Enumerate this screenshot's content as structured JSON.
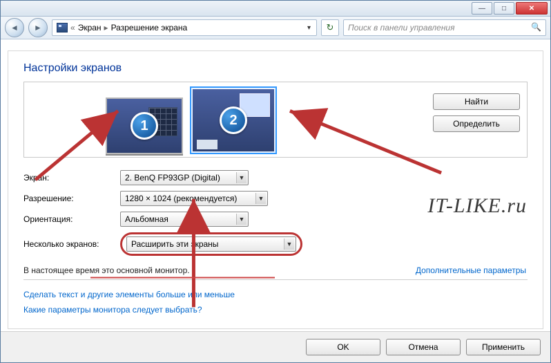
{
  "titlebar": {},
  "nav": {
    "crumb1": "Экран",
    "crumb2": "Разрешение экрана",
    "search_placeholder": "Поиск в панели управления"
  },
  "page": {
    "heading": "Настройки экранов",
    "monitor1_num": "1",
    "monitor2_num": "2",
    "btn_find": "Найти",
    "btn_detect": "Определить",
    "label_screen": "Экран:",
    "value_screen": "2. BenQ FP93GP (Digital)",
    "label_resolution": "Разрешение:",
    "value_resolution": "1280 × 1024 (рекомендуется)",
    "label_orientation": "Ориентация:",
    "value_orientation": "Альбомная",
    "label_multi": "Несколько экранов:",
    "value_multi": "Расширить эти экраны",
    "primary_note": "В настоящее время это основной монитор.",
    "advanced_link": "Дополнительные параметры",
    "link_textsize": "Сделать текст и другие элементы больше или меньше",
    "link_which": "Какие параметры монитора следует выбрать?",
    "watermark": "IT-LIKE.ru"
  },
  "footer": {
    "ok": "OK",
    "cancel": "Отмена",
    "apply": "Применить"
  }
}
